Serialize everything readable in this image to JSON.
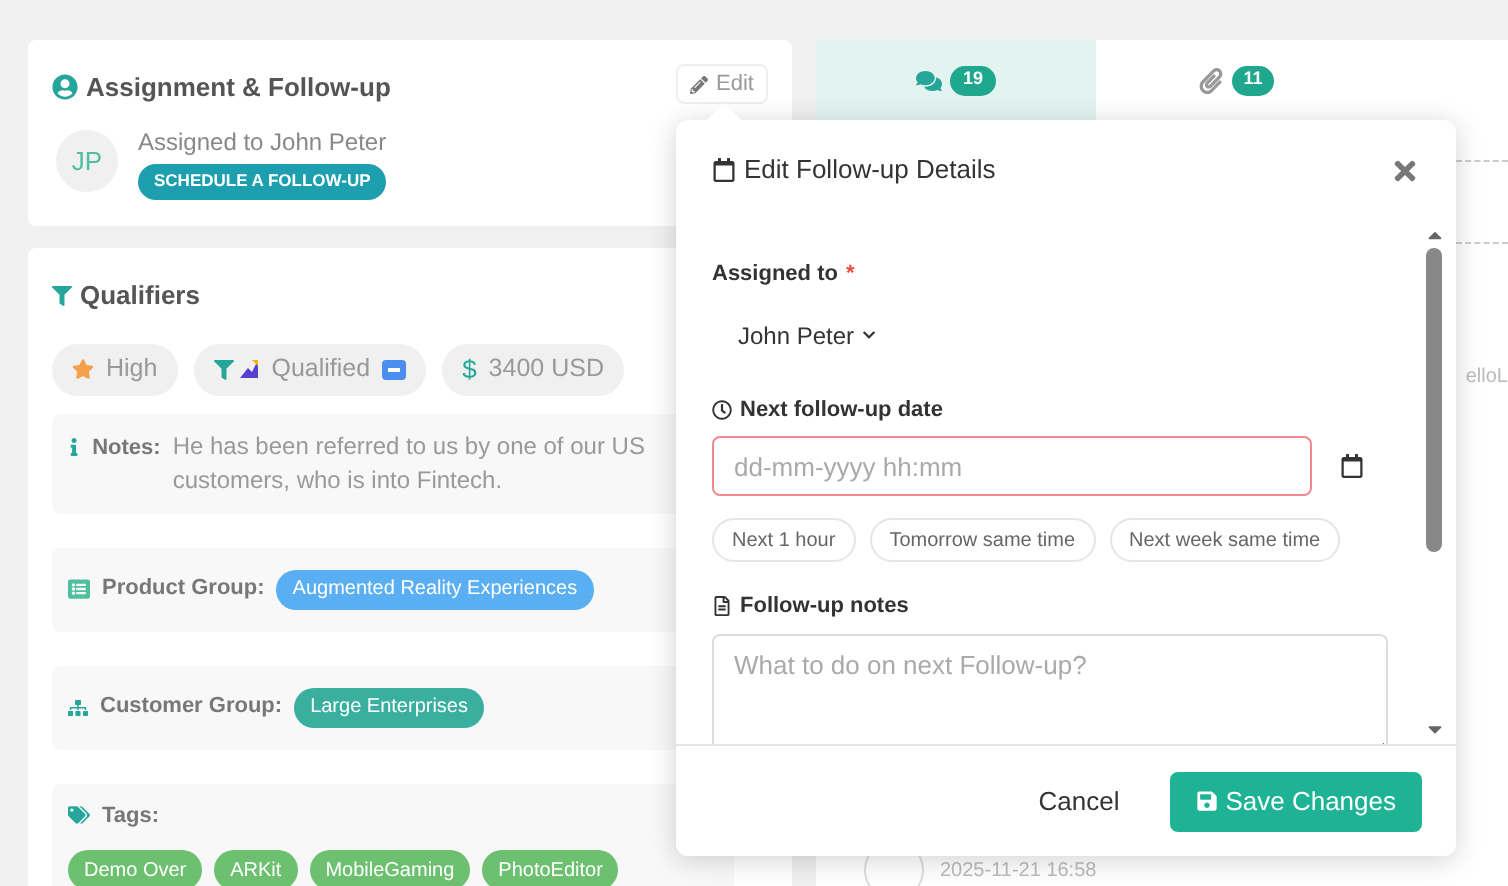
{
  "assignment": {
    "title": "Assignment & Follow-up",
    "edit": "Edit",
    "initials": "JP",
    "assigned_text": "Assigned to John Peter",
    "schedule_button": "SCHEDULE A FOLLOW-UP"
  },
  "qualifiers": {
    "title": "Qualifiers",
    "chips": [
      {
        "kind": "priority",
        "label": "High"
      },
      {
        "kind": "stage",
        "label": "Qualified"
      },
      {
        "kind": "value",
        "label": "$",
        "text": "3400 USD"
      }
    ],
    "notes_label": "Notes:",
    "notes": "He has been referred to us by one of our US customers, who is into Fintech.",
    "product_group_label": "Product Group:",
    "product_group": "Augmented Reality Experiences",
    "customer_group_label": "Customer Group:",
    "customer_group": "Large Enterprises",
    "tags_label": "Tags:",
    "tags": [
      "Demo Over",
      "ARKit",
      "MobileGaming",
      "PhotoEditor"
    ]
  },
  "activity": {
    "tabs": [
      {
        "kind": "comments",
        "count": "19",
        "selected": true
      },
      {
        "kind": "attachments",
        "count": "11",
        "selected": false
      }
    ],
    "partial_text": "elloL",
    "timestamp": "2025-11-21 16:58"
  },
  "modal": {
    "title": "Edit Follow-up Details",
    "assigned_label": "Assigned to",
    "required_mark": "*",
    "assignee": "John Peter",
    "date_label": "Next follow-up date",
    "date_placeholder": "dd-mm-yyyy hh:mm",
    "quick_options": [
      "Next 1 hour",
      "Tomorrow same time",
      "Next week same time"
    ],
    "notes_label": "Follow-up notes",
    "notes_placeholder": "What to do on next Follow-up?",
    "cancel": "Cancel",
    "save": "Save Changes"
  }
}
